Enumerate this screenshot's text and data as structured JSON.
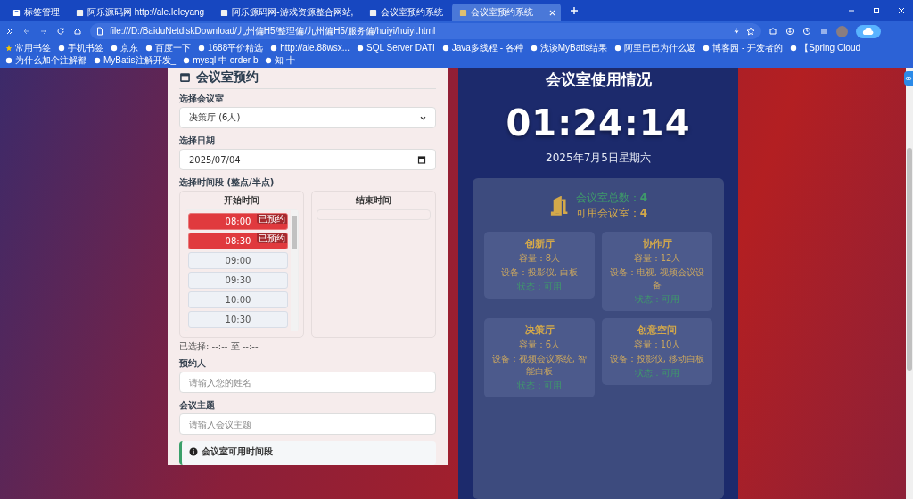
{
  "browser": {
    "tabs": [
      {
        "label": "标签管理",
        "kind": "manager",
        "selected": false
      },
      {
        "label": "阿乐源码网 http://ale.leleyang",
        "kind": "page",
        "selected": false
      },
      {
        "label": "阿乐源码网-游戏资源整合网站,",
        "kind": "page",
        "selected": false
      },
      {
        "label": "会议室预约系统",
        "kind": "page",
        "selected": false
      },
      {
        "label": "会议室预约系统",
        "kind": "page",
        "selected": true
      }
    ],
    "address": "file:///D:/BaiduNetdiskDownload/九州偏H5/整理偏/九州偏H5/服务偏/huiyi/huiyi.html",
    "bookmarks": [
      "常用书签",
      "手机书签",
      "京东",
      "百度一下",
      "1688平价精选",
      "http://ale.88wsx...",
      "SQL Server DATI",
      "Java多线程 - 各种",
      "浅谈MyBatis结果",
      "阿里巴巴为什么返",
      "博客园 - 开发者的",
      "【Spring Cloud",
      "为什么加个注解都",
      "MyBatis注解开发_",
      "mysql 中 order b",
      "知 十"
    ]
  },
  "booking": {
    "title": "会议室预约",
    "room_label": "选择会议室",
    "room_value": "决策厅 (6人)",
    "date_label": "选择日期",
    "date_value": "2025/07/04",
    "time_label": "选择时间段 (整点/半点)",
    "start_title": "开始时间",
    "end_title": "结束时间",
    "start_slots": [
      {
        "time": "08:00",
        "booked": true,
        "badge": "已预约"
      },
      {
        "time": "08:30",
        "booked": true,
        "badge": "已预约"
      },
      {
        "time": "09:00",
        "booked": false
      },
      {
        "time": "09:30",
        "booked": false
      },
      {
        "time": "10:00",
        "booked": false
      },
      {
        "time": "10:30",
        "booked": false
      }
    ],
    "selected_text": "已选择: --:-- 至 --:--",
    "person_label": "预约人",
    "person_placeholder": "请输入您的姓名",
    "topic_label": "会议主题",
    "topic_placeholder": "请输入会议主题",
    "info_title": "会议室可用时间段"
  },
  "status": {
    "title": "会议室使用情况",
    "clock": "01:24:14",
    "date": "2025年7月5日星期六",
    "total_label": "会议室总数：",
    "total": "4",
    "available_label": "可用会议室：",
    "available": "4",
    "rooms": [
      {
        "name": "创新厅",
        "capacity": "容量：8人",
        "equipment": "设备：投影仪, 白板",
        "status": "状态：可用",
        "available": true
      },
      {
        "name": "协作厅",
        "capacity": "容量：12人",
        "equipment": "设备：电视, 视频会议设备",
        "status": "状态：可用",
        "available": true
      },
      {
        "name": "决策厅",
        "capacity": "容量：6人",
        "equipment": "设备：视频会议系统, 智能白板",
        "status": "状态：可用",
        "available": true
      },
      {
        "name": "创意空间",
        "capacity": "容量：10人",
        "equipment": "设备：投影仪, 移动白板",
        "status": "状态：可用",
        "available": true
      }
    ]
  }
}
